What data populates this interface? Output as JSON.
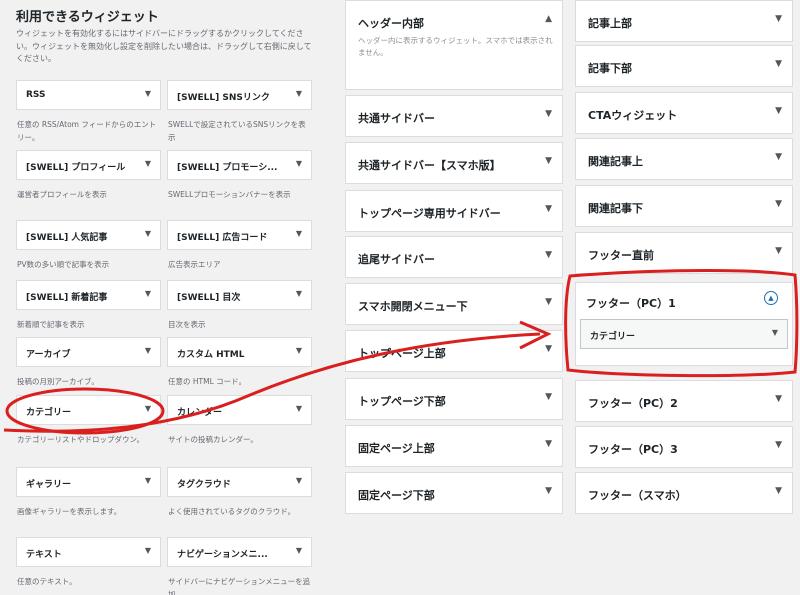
{
  "available": {
    "title": "利用できるウィジェット",
    "description": "ウィジェットを有効化するにはサイドバーにドラッグするかクリックしてください。ウィジェットを無効化し設定を削除したい場合は、ドラッグして右側に戻してください。",
    "widgets": [
      {
        "label": "RSS",
        "desc": "任意の RSS/Atom フィードからのエントリー。"
      },
      {
        "label": "[SWELL] SNSリンク",
        "desc": "SWELLで設定されているSNSリンクを表示"
      },
      {
        "label": "[SWELL] プロフィール",
        "desc": "運営者プロフィールを表示"
      },
      {
        "label": "[SWELL] プロモーシ...",
        "desc": "SWELLプロモーションバナーを表示"
      },
      {
        "label": "[SWELL] 人気記事",
        "desc": "PV数の多い順で記事を表示"
      },
      {
        "label": "[SWELL] 広告コード",
        "desc": "広告表示エリア"
      },
      {
        "label": "[SWELL] 新着記事",
        "desc": "新着順で記事を表示"
      },
      {
        "label": "[SWELL] 目次",
        "desc": "目次を表示"
      },
      {
        "label": "アーカイブ",
        "desc": "投稿の月別アーカイブ。"
      },
      {
        "label": "カスタム HTML",
        "desc": "任意の HTML コード。"
      },
      {
        "label": "カテゴリー",
        "desc": "カテゴリーリストやドロップダウン。"
      },
      {
        "label": "カレンダー",
        "desc": "サイトの投稿カレンダー。"
      },
      {
        "label": "ギャラリー",
        "desc": "画像ギャラリーを表示します。"
      },
      {
        "label": "タグクラウド",
        "desc": "よく使用されているタグのクラウド。"
      },
      {
        "label": "テキスト",
        "desc": "任意のテキスト。"
      },
      {
        "label": "ナビゲーションメニ...",
        "desc": "サイドバーにナビゲーションメニューを追加。"
      }
    ]
  },
  "middle_areas": [
    {
      "label": "ヘッダー内部",
      "desc": "ヘッダー内に表示するウィジェット。スマホでは表示されません。"
    },
    {
      "label": "共通サイドバー"
    },
    {
      "label": "共通サイドバー【スマホ版】"
    },
    {
      "label": "トップページ専用サイドバー"
    },
    {
      "label": "追尾サイドバー"
    },
    {
      "label": "スマホ開閉メニュー下"
    },
    {
      "label": "トップページ上部"
    },
    {
      "label": "トップページ下部"
    },
    {
      "label": "固定ページ上部"
    },
    {
      "label": "固定ページ下部"
    }
  ],
  "right_areas": [
    {
      "label": "記事上部"
    },
    {
      "label": "記事下部"
    },
    {
      "label": "CTAウィジェット"
    },
    {
      "label": "関連記事上"
    },
    {
      "label": "関連記事下"
    },
    {
      "label": "フッター直前"
    },
    {
      "label": "フッター（PC）1",
      "inner_widget": "カテゴリー"
    },
    {
      "label": "フッター（PC）2"
    },
    {
      "label": "フッター（PC）3"
    },
    {
      "label": "フッター（スマホ）"
    }
  ],
  "icons": {
    "arrow_down": "▼",
    "arrow_up": "▲"
  },
  "colors": {
    "annotation": "#d9201f",
    "accent": "#2271b1"
  }
}
